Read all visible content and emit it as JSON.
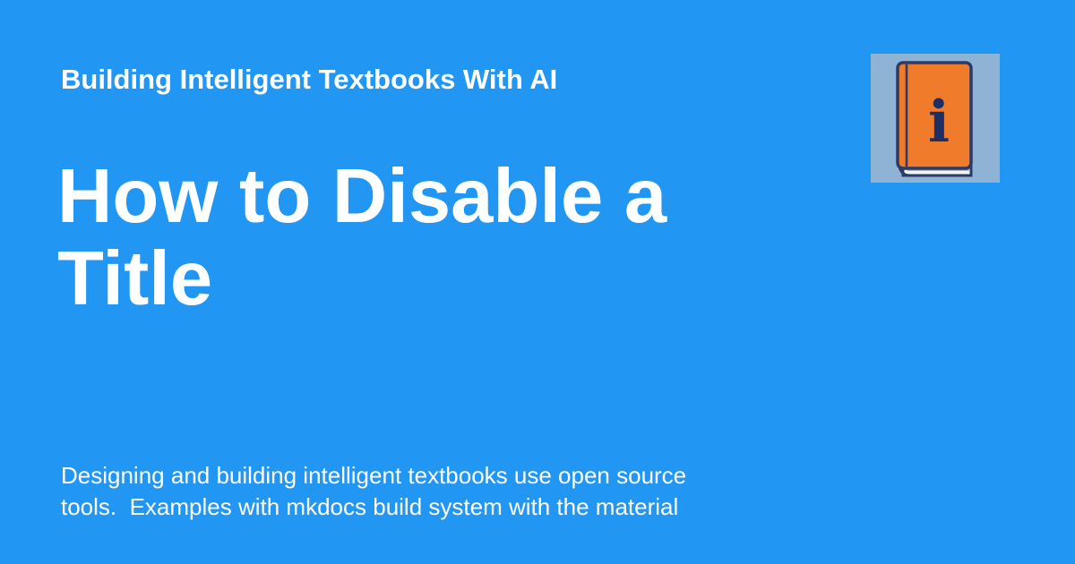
{
  "site": {
    "name": "Building Intelligent Textbooks With AI"
  },
  "page": {
    "title_lines": [
      "How to Disable a",
      "Title"
    ],
    "description_lines": [
      "Designing and building intelligent textbooks use open source",
      "tools.  Examples with mkdocs build system with the material"
    ]
  },
  "logo": {
    "icon": "book-info-icon",
    "glyph": "i"
  },
  "colors": {
    "background": "#2196f3",
    "text": "#ffffff",
    "logo_background": "#8fb3d5",
    "book_cover": "#f07b2a",
    "book_outline": "#2b3a67",
    "book_letter": "#1f2f63"
  }
}
